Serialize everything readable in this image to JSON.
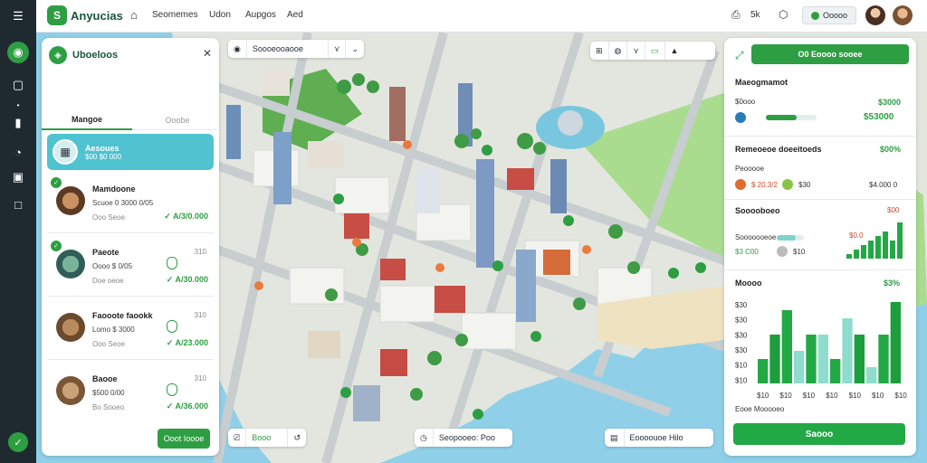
{
  "app": {
    "logo_text": "Anyucias"
  },
  "nav": {
    "links": [
      "Seomemes",
      "Udon",
      "Aupgos",
      "Aed"
    ]
  },
  "topbar": {
    "notif_count": "5k",
    "pill_label": "Ooooo"
  },
  "left_panel": {
    "title": "Uboeloos",
    "tabs": [
      "Mangoe",
      "Ooobe"
    ],
    "selected": {
      "title": "Aesoues",
      "subtitle": "$00 $0 000"
    },
    "items": [
      {
        "name": "Mamdoone",
        "sub": "Scuoe 0 3000 0/05",
        "meta": "Ooo Seoe",
        "num": "",
        "price": "✓ A/3/0.000"
      },
      {
        "name": "Paeote",
        "sub": "Oooo $ 0/05",
        "meta": "Doe oeoe",
        "num": "310",
        "price": "✓ A/30.000"
      },
      {
        "name": "Faooote faookk",
        "sub": "Lomo $ 3000",
        "meta": "Ooo Seoe",
        "num": "310",
        "price": "✓ A/23.000"
      },
      {
        "name": "Baooe",
        "sub": "$500 0/00",
        "meta": "Bo Sooeo",
        "num": "310",
        "price": "✓ A/36.000"
      }
    ],
    "cta": "Ooot Ioooe"
  },
  "map_controls": {
    "top_search": "Soooeooaooe",
    "bottom_left": "Booo",
    "bottom_center": "Seopooeo: Poo",
    "bottom_right": "Eoooouoe Hilo"
  },
  "right_panel": {
    "top_button": "O0 Eoooo sooee",
    "sections": [
      {
        "title": "Maeogmamot",
        "value": "$3000",
        "sub_label": "$0ooo",
        "sub_value": "$53000",
        "progress": 0.6
      },
      {
        "title": "Remeoeoe doeeitoeds",
        "value": "$00%",
        "row_label": "Peooooe",
        "a": "$ 20.3/2",
        "b": "$30",
        "c": "$4.000 0"
      },
      {
        "title": "Sooooboeo",
        "value": "$00",
        "label": "Sooooooeoe",
        "a": "$3 C00",
        "b": "$10",
        "k": "$0.0"
      }
    ],
    "chart": {
      "title": "Moooo",
      "legend": "Eooe Mooooeo",
      "value": "$3%",
      "y_ticks": [
        "$30",
        "$30",
        "$30",
        "$30",
        "$10",
        "$10"
      ],
      "x_ticks": [
        "$10",
        "$10",
        "$10",
        "$10",
        "$10",
        "$10",
        "$10"
      ]
    },
    "bottom_button": "Saooo"
  },
  "chart_data": {
    "type": "bar",
    "categories": [
      "$10",
      "$10",
      "$10",
      "$10",
      "$10",
      "$10",
      "$10",
      "$10",
      "$10",
      "$10",
      "$10",
      "$10"
    ],
    "series": [
      {
        "values": [
          3,
          6,
          9,
          4,
          6,
          6,
          3,
          8,
          6,
          2,
          6,
          10
        ]
      }
    ],
    "ylim": [
      0,
      10
    ]
  },
  "mini_chart": {
    "values": [
      1,
      2,
      3,
      4,
      5,
      6,
      4,
      8
    ]
  },
  "colors": {
    "accent": "#2e9e43",
    "teal": "#7fd4cb",
    "sidebar": "#1f2a30"
  }
}
